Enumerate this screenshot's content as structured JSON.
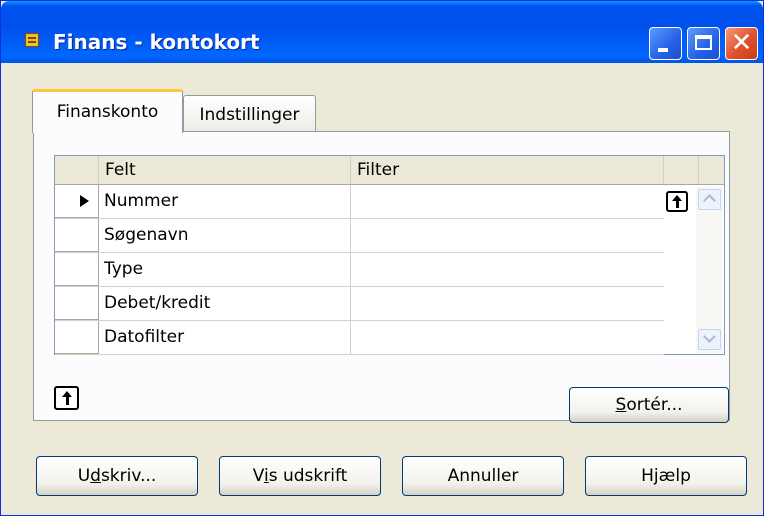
{
  "window": {
    "title": "Finans - kontokort",
    "title_icon": "form-icon",
    "controls": {
      "minimize": "minimize-icon",
      "maximize": "maximize-icon",
      "close": "close-icon",
      "close_glyph": "✕"
    }
  },
  "tabs": [
    {
      "label": "Finanskonto",
      "active": true
    },
    {
      "label": "Indstillinger",
      "active": false
    }
  ],
  "grid": {
    "columns": [
      "Felt",
      "Filter"
    ],
    "rows": [
      {
        "felt": "Nummer",
        "filter": "",
        "current": true
      },
      {
        "felt": "Søgenavn",
        "filter": "",
        "current": false
      },
      {
        "felt": "Type",
        "filter": "",
        "current": false
      },
      {
        "felt": "Debet/kredit",
        "filter": "",
        "current": false
      },
      {
        "felt": "Datofilter",
        "filter": "",
        "current": false
      }
    ]
  },
  "buttons": {
    "sort": {
      "mnemonic": "S",
      "rest": "ortér..."
    },
    "udskriv": {
      "before": "U",
      "mnemonic": "d",
      "rest": "skriv..."
    },
    "vis": {
      "before": "V",
      "mnemonic": "i",
      "rest": "s udskrift"
    },
    "annuller": "Annuller",
    "hjaelp": "Hjælp"
  },
  "colors": {
    "titlebar": "#0054e3",
    "dialog_bg": "#ece9d8",
    "active_tab_accent": "#ffc83c",
    "close_button": "#e0502b"
  }
}
